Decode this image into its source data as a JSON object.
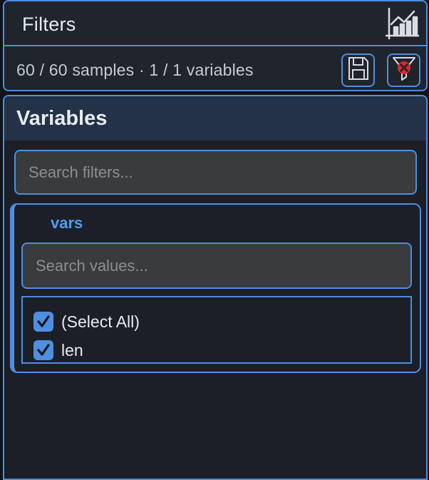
{
  "header": {
    "title": "Filters",
    "icon": "chart-bars-icon"
  },
  "status": {
    "text": "60 / 60 samples · 1 / 1 variables",
    "save_icon": "floppy-disk-icon",
    "clear_icon": "clear-filter-icon"
  },
  "section": {
    "title": "Variables",
    "search_placeholder": "Search filters..."
  },
  "filter": {
    "name": "vars",
    "search_placeholder": "Search values...",
    "options": [
      {
        "label": "(Select All)",
        "checked": true
      },
      {
        "label": "len",
        "checked": true
      }
    ]
  },
  "colors": {
    "accent": "#4d8fe0",
    "panel": "#1f242d",
    "section_header": "#233247",
    "input_bg": "#3a3b3d",
    "clear_x": "#e0262b"
  }
}
